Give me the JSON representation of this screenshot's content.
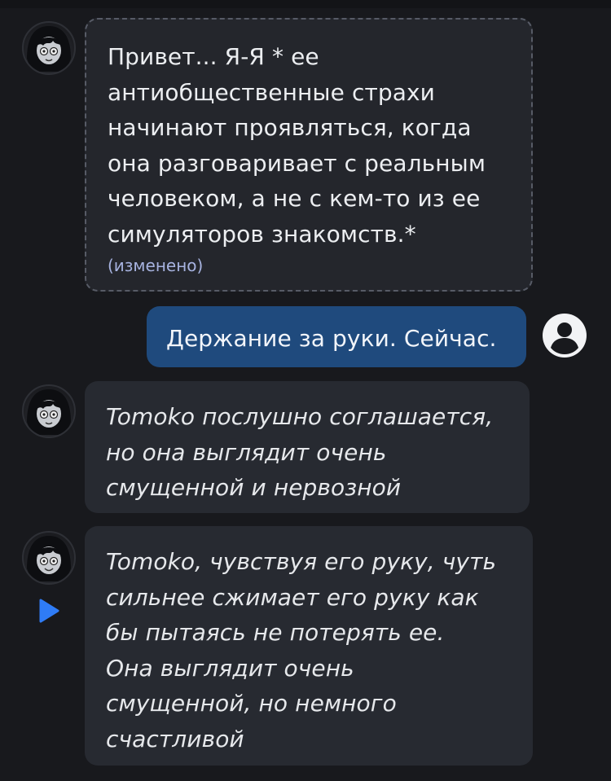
{
  "messages": [
    {
      "author": "bot",
      "text": "Привет... Я-Я * ее\nантиобщественные страхи\nначинают проявляться, когда\nона разговаривает с реальным\nчеловеком, а не с кем-то из ее\nсимуляторов знакомств.*",
      "edited_label": "(изменено)"
    },
    {
      "author": "user",
      "text": "Держание за руки. Сейчас."
    },
    {
      "author": "bot",
      "text": "Tomoko послушно соглашается,\nно она выглядит очень\nсмущенной и нервозной"
    },
    {
      "author": "bot",
      "text": "Tomoko, чувствуя его руку, чуть\nсильнее сжимает его руку как\nбы пытаясь не потерять ее.\nОна выглядит очень\nсмущенной, но немного\nсчастливой"
    }
  ],
  "icons": {
    "user_avatar": "user-circle-icon",
    "play": "play-icon"
  },
  "colors": {
    "background": "#18191d",
    "bot_bubble": "#272a31",
    "user_bubble": "#1f4a7d",
    "edited_label": "#a7b3e0",
    "accent": "#2f7cf6"
  }
}
